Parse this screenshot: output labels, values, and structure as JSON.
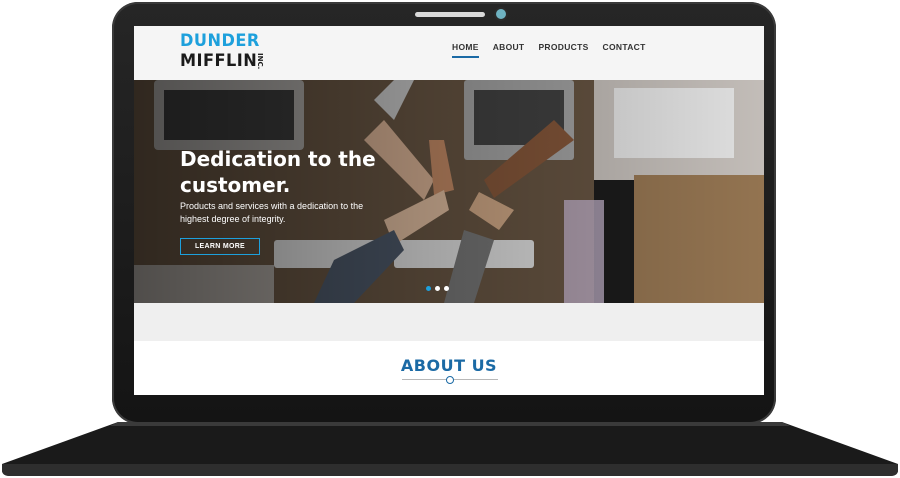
{
  "site": {
    "logo": {
      "line1": "DUNDER",
      "line2": "MIFFLIN",
      "suffix": "INC."
    },
    "nav": [
      {
        "label": "HOME",
        "active": true
      },
      {
        "label": "ABOUT",
        "active": false
      },
      {
        "label": "PRODUCTS",
        "active": false
      },
      {
        "label": "CONTACT",
        "active": false
      }
    ],
    "hero": {
      "title": "Dedication to the customer.",
      "subtitle": "Products and services with a dedication to the highest degree of integrity.",
      "button": "LEARN MORE",
      "slides": 3,
      "active_slide": 1
    },
    "about": {
      "title": "ABOUT US"
    }
  },
  "colors": {
    "accent": "#1da0dc",
    "heading": "#1b6aa5",
    "laptop": "#1c1c1c"
  },
  "icons": [
    "camera-icon",
    "slider-dot-icon",
    "divider-dot-icon"
  ]
}
